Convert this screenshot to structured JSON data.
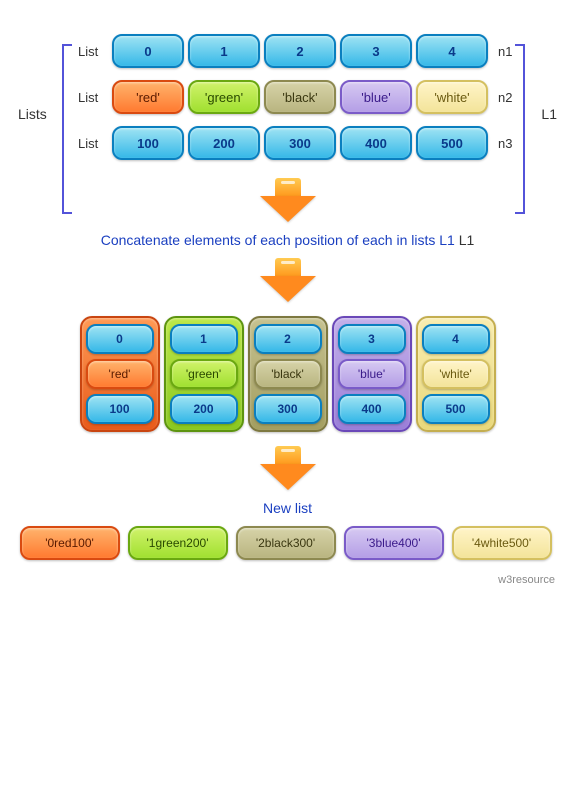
{
  "labels": {
    "lists": "Lists",
    "list": "List",
    "L1": "L1",
    "n1": "n1",
    "n2": "n2",
    "n3": "n3"
  },
  "rows": {
    "r1": [
      "0",
      "1",
      "2",
      "3",
      "4"
    ],
    "r2": [
      "'red'",
      "'green'",
      "'black'",
      "'blue'",
      "'white'"
    ],
    "r3": [
      "100",
      "200",
      "300",
      "400",
      "500"
    ]
  },
  "caption1": "Concatenate elements of each position of each in lists L1",
  "caption2": "New list",
  "newlist": [
    "'0red100'",
    "'1green200'",
    "'2black300'",
    "'3blue400'",
    "'4white500'"
  ],
  "footer": "w3resource"
}
